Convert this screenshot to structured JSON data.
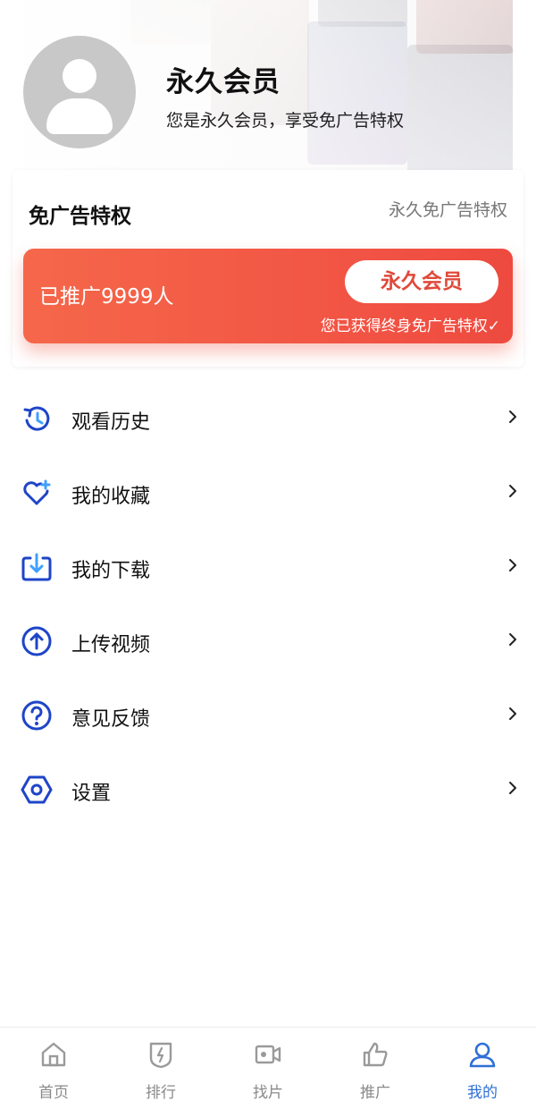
{
  "header": {
    "title": "永久会员",
    "description": "您是永久会员，享受免广告特权"
  },
  "privilege": {
    "title": "免广告特权",
    "subtitle": "永久免广告特权",
    "promoted_count": "已推广9999人",
    "vip_button": "永久会员",
    "note": "您已获得终身免广告特权✓",
    "gradient_colors": [
      "#f5674a",
      "#ee4a3f"
    ]
  },
  "menu": {
    "items": [
      {
        "label": "观看历史",
        "icon": "history-icon"
      },
      {
        "label": "我的收藏",
        "icon": "heart-plus-icon"
      },
      {
        "label": "我的下载",
        "icon": "download-icon"
      },
      {
        "label": "上传视频",
        "icon": "upload-icon"
      },
      {
        "label": "意见反馈",
        "icon": "question-icon"
      },
      {
        "label": "设置",
        "icon": "settings-icon"
      }
    ],
    "icon_color": "#1e45c8"
  },
  "bottom_nav": {
    "items": [
      {
        "label": "首页",
        "icon": "home-icon"
      },
      {
        "label": "排行",
        "icon": "ranking-icon"
      },
      {
        "label": "找片",
        "icon": "video-camera-icon"
      },
      {
        "label": "推广",
        "icon": "thumbs-up-icon"
      },
      {
        "label": "我的",
        "icon": "user-icon"
      }
    ],
    "active": "我的",
    "active_color": "#2f6fd6",
    "inactive_color": "#8a8a8a"
  }
}
